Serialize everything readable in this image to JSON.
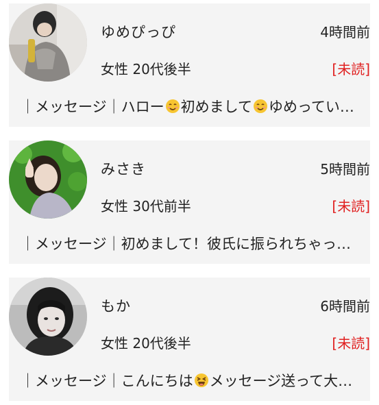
{
  "threads": [
    {
      "name": "ゆめぴっぴ",
      "time": "4時間前",
      "profile": "女性 20代後半",
      "status": "[未読]",
      "preview": {
        "prefix": "｜メッセージ｜ハロー",
        "mid": "初めまして",
        "suffix": "ゆめってい…",
        "emoji": "smiling-face-emoji"
      },
      "avatar_icon": "avatar-photo-icon"
    },
    {
      "name": "みさき",
      "time": "5時間前",
      "profile": "女性 30代前半",
      "status": "[未読]",
      "preview": {
        "text": "｜メッセージ｜初めまして！彼氏に振られちゃっ…"
      },
      "avatar_icon": "avatar-photo-icon"
    },
    {
      "name": "もか",
      "time": "6時間前",
      "profile": "女性 20代後半",
      "status": "[未読]",
      "preview": {
        "prefix": "｜メッセージ｜こんにちは",
        "suffix": "メッセージ送って大…",
        "emoji": "laughing-face-emoji"
      },
      "avatar_icon": "avatar-photo-icon"
    }
  ],
  "colors": {
    "card_background": "#f4f4f4",
    "unread_status": "#e02020",
    "text": "#222222"
  }
}
